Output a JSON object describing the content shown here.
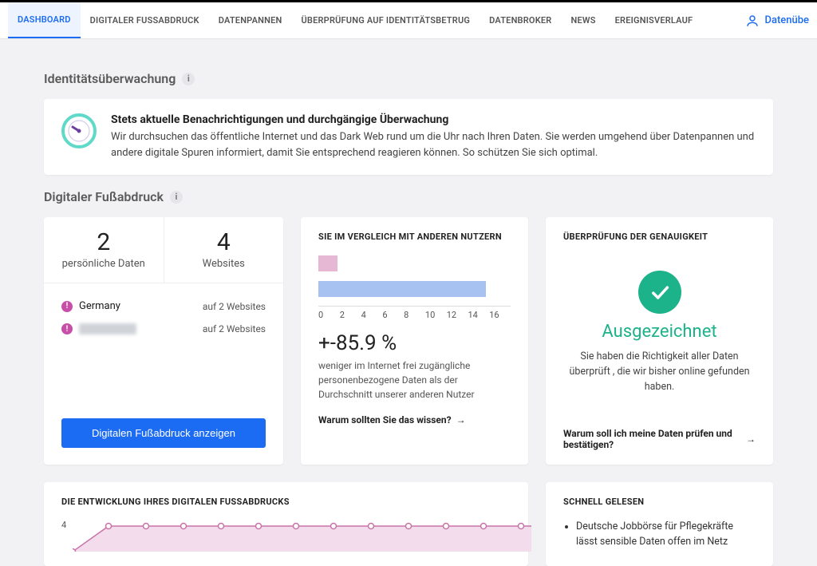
{
  "nav": {
    "items": [
      "DASHBOARD",
      "DIGITALER FUSSABDRUCK",
      "DATENPANNEN",
      "ÜBERPRÜFUNG AUF IDENTITÄTSBETRUG",
      "DATENBROKER",
      "NEWS",
      "EREIGNISVERLAUF"
    ],
    "active_index": 0,
    "right_label": "Datenübe"
  },
  "section_identity_title": "Identitätsüberwachung",
  "intro": {
    "title": "Stets aktuelle Benachrichtigungen und durchgängige Überwachung",
    "text": "Wir durchsuchen das öffentliche Internet und das Dark Web rund um die Uhr nach Ihren Daten. Sie werden umgehend über Datenpannen und andere digitale Spuren informiert, damit Sie entsprechend reagieren können. So schützen Sie sich optimal."
  },
  "section_footprint_title": "Digitaler Fußabdruck",
  "stats": {
    "personal_num": "2",
    "personal_lbl": "persönliche Daten",
    "websites_num": "4",
    "websites_lbl": "Websites"
  },
  "locations": {
    "row1_label": "Germany",
    "row1_right": "auf 2 Websites",
    "row2_right": "auf 2 Websites"
  },
  "footprint_button": "Digitalen Fußabdruck anzeigen",
  "compare": {
    "title": "SIE IM VERGLEICH MIT ANDEREN NUTZERN",
    "pct": "+-85.9 %",
    "desc": "weniger im Internet frei zugängliche personenbezogene Daten als der Durchschnitt unserer anderen Nutzer",
    "link": "Warum sollten Sie das wissen?"
  },
  "accuracy": {
    "title": "ÜBERPRÜFUNG DER GENAUIGKEIT",
    "big": "Ausgezeichnet",
    "desc": "Sie haben die Richtigkeit aller Daten überprüft , die wir bisher online gefunden haben.",
    "link": "Warum soll ich meine Daten prüfen und bestätigen?"
  },
  "trend": {
    "title": "DIE ENTWICKLUNG IHRES DIGITALEN FUSSABDRUCKS",
    "ylabel": "4"
  },
  "schnell": {
    "title": "SCHNELL GELESEN",
    "item1": "Deutsche Jobbörse für Pflegekräfte lässt sensible Daten offen im Netz"
  },
  "chart_data": {
    "bars": {
      "type": "bar",
      "orientation": "horizontal",
      "title": "SIE IM VERGLEICH MIT ANDEREN NUTZERN",
      "xlim": [
        0,
        16
      ],
      "ticks": [
        0,
        2,
        4,
        6,
        8,
        10,
        12,
        14,
        16
      ],
      "series": [
        {
          "name": "you",
          "value": 1.5,
          "color": "#e6b8d4"
        },
        {
          "name": "others",
          "value": 14,
          "color": "#a7c2f1"
        }
      ]
    },
    "trend": {
      "type": "line",
      "y_value": 4,
      "points": 13,
      "color": "#d8a6c7",
      "fill": true
    }
  }
}
